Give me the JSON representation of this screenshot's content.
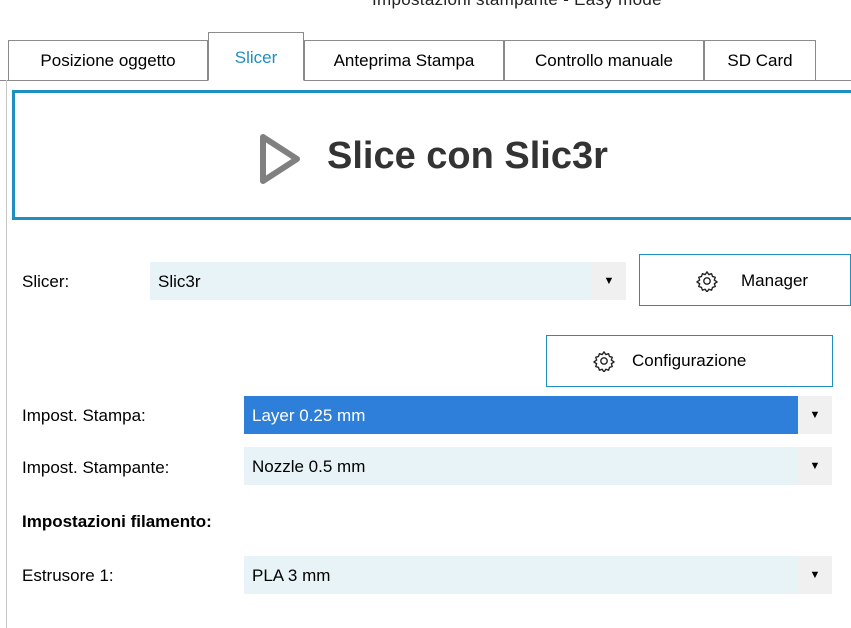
{
  "window": {
    "title": "Impostazioni stampante - Easy mode"
  },
  "tabs": [
    {
      "label": "Posizione oggetto"
    },
    {
      "label": "Slicer"
    },
    {
      "label": "Anteprima Stampa"
    },
    {
      "label": "Controllo manuale"
    },
    {
      "label": "SD Card"
    }
  ],
  "slice_button": {
    "label": "Slice con Slic3r",
    "icon": "play-icon"
  },
  "slicer": {
    "label": "Slicer:",
    "value": "Slic3r",
    "manager_label": "Manager"
  },
  "configurazione_label": "Configurazione",
  "print_settings": {
    "label": "Impost. Stampa:",
    "value": "Layer 0.25 mm"
  },
  "printer_settings": {
    "label": "Impost. Stampante:",
    "value": "Nozzle 0.5 mm"
  },
  "filament": {
    "heading": "Impostazioni filamento:",
    "extruder_label": "Estrusore 1:",
    "extruder_value": "PLA 3 mm"
  },
  "colors": {
    "accent": "#1f8fbf",
    "selection": "#2d7fd9",
    "combo_bg": "#e8f3f7"
  }
}
